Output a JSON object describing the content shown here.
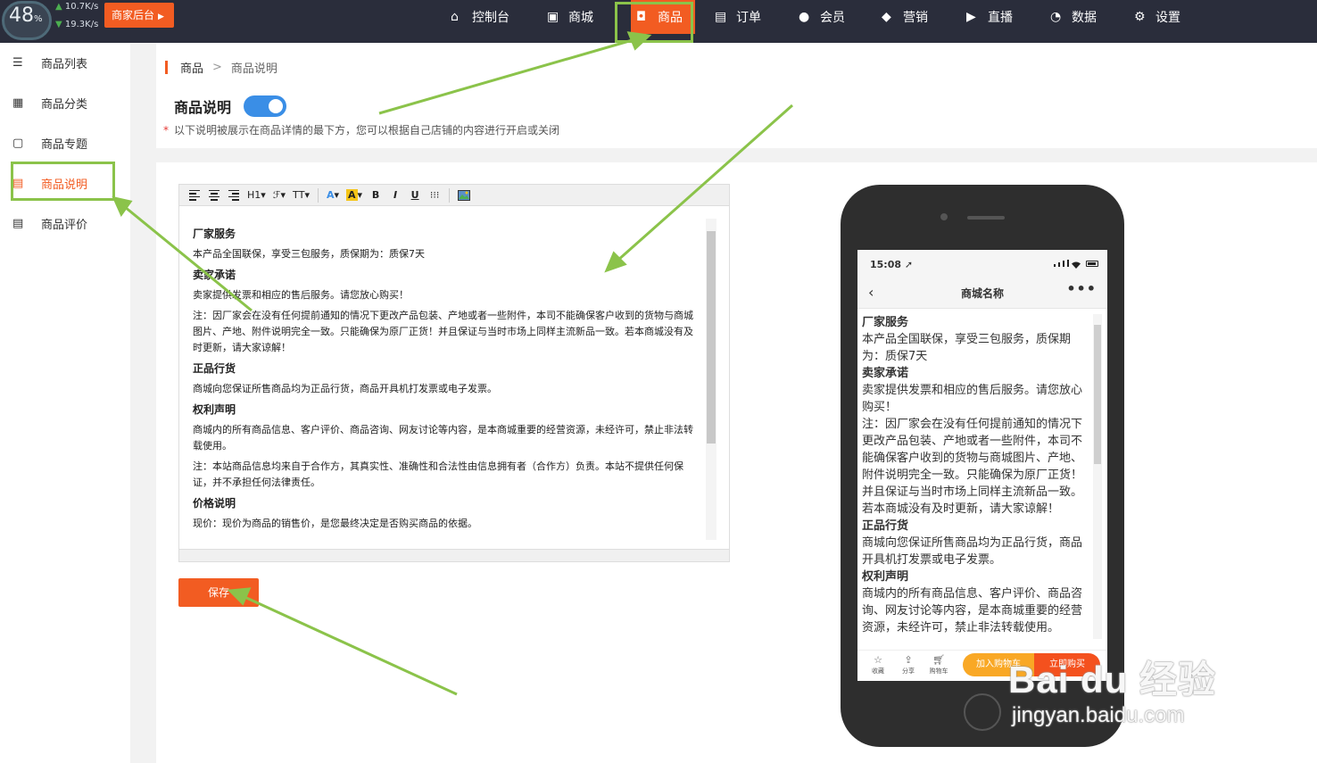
{
  "speed": {
    "percent": "48",
    "percent_unit": "%",
    "up": "10.7",
    "down": "19.3",
    "unit": "K/s"
  },
  "merchant_button": "商家后台",
  "nav": [
    {
      "label": "控制台",
      "icon": "home-icon"
    },
    {
      "label": "商城",
      "icon": "store-icon"
    },
    {
      "label": "商品",
      "icon": "bag-icon",
      "active": true
    },
    {
      "label": "订单",
      "icon": "order-icon"
    },
    {
      "label": "会员",
      "icon": "user-icon"
    },
    {
      "label": "营销",
      "icon": "box-icon"
    },
    {
      "label": "直播",
      "icon": "live-icon"
    },
    {
      "label": "数据",
      "icon": "pie-icon"
    },
    {
      "label": "设置",
      "icon": "gear-icon"
    }
  ],
  "sidebar": [
    {
      "label": "商品列表",
      "icon": "list-icon"
    },
    {
      "label": "商品分类",
      "icon": "grid-icon"
    },
    {
      "label": "商品专题",
      "icon": "topic-icon"
    },
    {
      "label": "商品说明",
      "icon": "doc-icon",
      "active": true
    },
    {
      "label": "商品评价",
      "icon": "review-icon"
    }
  ],
  "breadcrumb": {
    "root": "商品",
    "sep": ">",
    "current": "商品说明"
  },
  "page_title": "商品说明",
  "toggle_on": true,
  "note": {
    "star": "*",
    "text": "以下说明被展示在商品详情的最下方，您可以根据自己店铺的内容进行开启或关闭"
  },
  "editor": {
    "toolbar": [
      "H1",
      "T",
      "A",
      "A",
      "B",
      "I",
      "U"
    ],
    "body": [
      {
        "h": true,
        "t": "厂家服务"
      },
      {
        "h": false,
        "t": "本产品全国联保，享受三包服务，质保期为：质保7天"
      },
      {
        "h": true,
        "t": "卖家承诺"
      },
      {
        "h": false,
        "t": "卖家提供发票和相应的售后服务。请您放心购买！"
      },
      {
        "h": false,
        "t": "注：因厂家会在没有任何提前通知的情况下更改产品包装、产地或者一些附件，本司不能确保客户收到的货物与商城图片、产地、附件说明完全一致。只能确保为原厂正货！并且保证与当时市场上同样主流新品一致。若本商城没有及时更新，请大家谅解！"
      },
      {
        "h": true,
        "t": "正品行货"
      },
      {
        "h": false,
        "t": "商城向您保证所售商品均为正品行货，商品开具机打发票或电子发票。"
      },
      {
        "h": true,
        "t": "权利声明"
      },
      {
        "h": false,
        "t": "商城内的所有商品信息、客户评价、商品咨询、网友讨论等内容，是本商城重要的经营资源，未经许可，禁止非法转载使用。"
      },
      {
        "h": false,
        "t": "注：本站商品信息均来自于合作方，其真实性、准确性和合法性由信息拥有者（合作方）负责。本站不提供任何保证，并不承担任何法律责任。"
      },
      {
        "h": true,
        "t": "价格说明"
      },
      {
        "h": false,
        "t": "现价：现价为商品的销售价，是您最终决定是否购买商品的依据。"
      }
    ]
  },
  "save_button": "保存",
  "phone": {
    "time": "15:08",
    "title": "商城名称",
    "more": "•••",
    "body": [
      {
        "h": true,
        "t": "厂家服务"
      },
      {
        "h": false,
        "t": "本产品全国联保，享受三包服务，质保期为：质保7天"
      },
      {
        "h": true,
        "t": "卖家承诺"
      },
      {
        "h": false,
        "t": "卖家提供发票和相应的售后服务。请您放心购买！"
      },
      {
        "h": false,
        "t": "注：因厂家会在没有任何提前通知的情况下更改产品包装、产地或者一些附件，本司不能确保客户收到的货物与商城图片、产地、附件说明完全一致。只能确保为原厂正货！并且保证与当时市场上同样主流新品一致。若本商城没有及时更新，请大家谅解！"
      },
      {
        "h": true,
        "t": "正品行货"
      },
      {
        "h": false,
        "t": "商城向您保证所售商品均为正品行货，商品开具机打发票或电子发票。"
      },
      {
        "h": true,
        "t": "权利声明"
      },
      {
        "h": false,
        "t": "商城内的所有商品信息、客户评价、商品咨询、网友讨论等内容，是本商城重要的经营资源，未经许可，禁止非法转载使用。"
      }
    ],
    "tabs": [
      {
        "label": "收藏",
        "icon": "star-icon"
      },
      {
        "label": "分享",
        "icon": "share-icon"
      },
      {
        "label": "购物车",
        "icon": "cart-icon"
      }
    ],
    "add_cart": "加入购物车",
    "buy_now": "立即购买"
  },
  "watermark": {
    "logo": "Bai du 经验",
    "url": "jingyan.baidu.com"
  },
  "colors": {
    "accent": "#f25c22",
    "topbar": "#2a2d3b",
    "highlight": "#8bc34a",
    "toggle": "#3a8ee6"
  }
}
